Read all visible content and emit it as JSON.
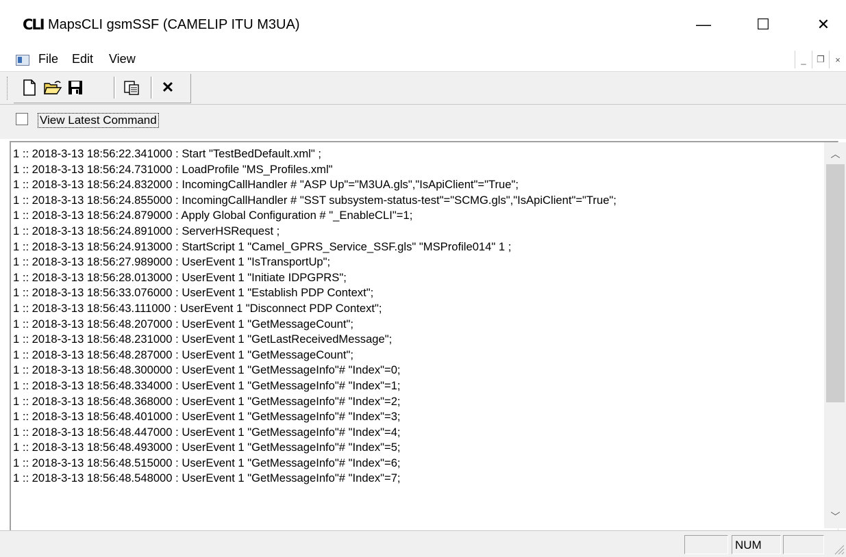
{
  "window": {
    "app_icon_text": "CLI",
    "title": "MapsCLI gsmSSF (CAMELIP ITU M3UA)",
    "controls": {
      "minimize": "—",
      "maximize": "☐",
      "close": "✕"
    }
  },
  "menu": {
    "file": "File",
    "edit": "Edit",
    "view": "View"
  },
  "mdi_controls": {
    "minimize": "_",
    "restore": "❐",
    "close": "×"
  },
  "toolbar": {
    "buttons": [
      "new-icon",
      "open-icon",
      "save-icon",
      "copy-icon",
      "delete-icon"
    ],
    "delete_glyph": "✕"
  },
  "options": {
    "view_latest_label": "View Latest Command",
    "view_latest_checked": false
  },
  "log": {
    "lines": [
      "1 :: 2018-3-13 18:56:22.341000 : Start \"TestBedDefault.xml\" ;",
      "1 :: 2018-3-13 18:56:24.731000 : LoadProfile \"MS_Profiles.xml\"",
      "1 :: 2018-3-13 18:56:24.832000 : IncomingCallHandler # \"ASP Up\"=\"M3UA.gls\",\"IsApiClient\"=\"True\";",
      "1 :: 2018-3-13 18:56:24.855000 : IncomingCallHandler # \"SST subsystem-status-test\"=\"SCMG.gls\",\"IsApiClient\"=\"True\";",
      "1 :: 2018-3-13 18:56:24.879000 : Apply Global Configuration # \"_EnableCLI\"=1;",
      "1 :: 2018-3-13 18:56:24.891000 : ServerHSRequest ;",
      "1 :: 2018-3-13 18:56:24.913000 : StartScript 1 \"Camel_GPRS_Service_SSF.gls\" \"MSProfile014\" 1 ;",
      "1 :: 2018-3-13 18:56:27.989000 : UserEvent 1 \"IsTransportUp\";",
      "1 :: 2018-3-13 18:56:28.013000 : UserEvent 1 \"Initiate IDPGPRS\";",
      "1 :: 2018-3-13 18:56:33.076000 : UserEvent 1 \"Establish PDP Context\";",
      "1 :: 2018-3-13 18:56:43.111000 : UserEvent 1 \"Disconnect PDP Context\";",
      "1 :: 2018-3-13 18:56:48.207000 : UserEvent 1 \"GetMessageCount\";",
      "1 :: 2018-3-13 18:56:48.231000 : UserEvent 1 \"GetLastReceivedMessage\";",
      "1 :: 2018-3-13 18:56:48.287000 : UserEvent 1 \"GetMessageCount\";",
      "1 :: 2018-3-13 18:56:48.300000 : UserEvent 1 \"GetMessageInfo\"# \"Index\"=0;",
      "1 :: 2018-3-13 18:56:48.334000 : UserEvent 1 \"GetMessageInfo\"# \"Index\"=1;",
      "1 :: 2018-3-13 18:56:48.368000 : UserEvent 1 \"GetMessageInfo\"# \"Index\"=2;",
      "1 :: 2018-3-13 18:56:48.401000 : UserEvent 1 \"GetMessageInfo\"# \"Index\"=3;",
      "1 :: 2018-3-13 18:56:48.447000 : UserEvent 1 \"GetMessageInfo\"# \"Index\"=4;",
      "1 :: 2018-3-13 18:56:48.493000 : UserEvent 1 \"GetMessageInfo\"# \"Index\"=5;",
      "1 :: 2018-3-13 18:56:48.515000 : UserEvent 1 \"GetMessageInfo\"# \"Index\"=6;",
      "1 :: 2018-3-13 18:56:48.548000 : UserEvent 1 \"GetMessageInfo\"# \"Index\"=7;"
    ]
  },
  "scrollbar": {
    "up": "︿",
    "down": "﹀"
  },
  "status": {
    "panel1": "",
    "num": "NUM",
    "panel3": ""
  },
  "colors": {
    "chrome": "#f0f0f0",
    "window": "#ffffff",
    "scroll_thumb": "#cdcdcd"
  }
}
